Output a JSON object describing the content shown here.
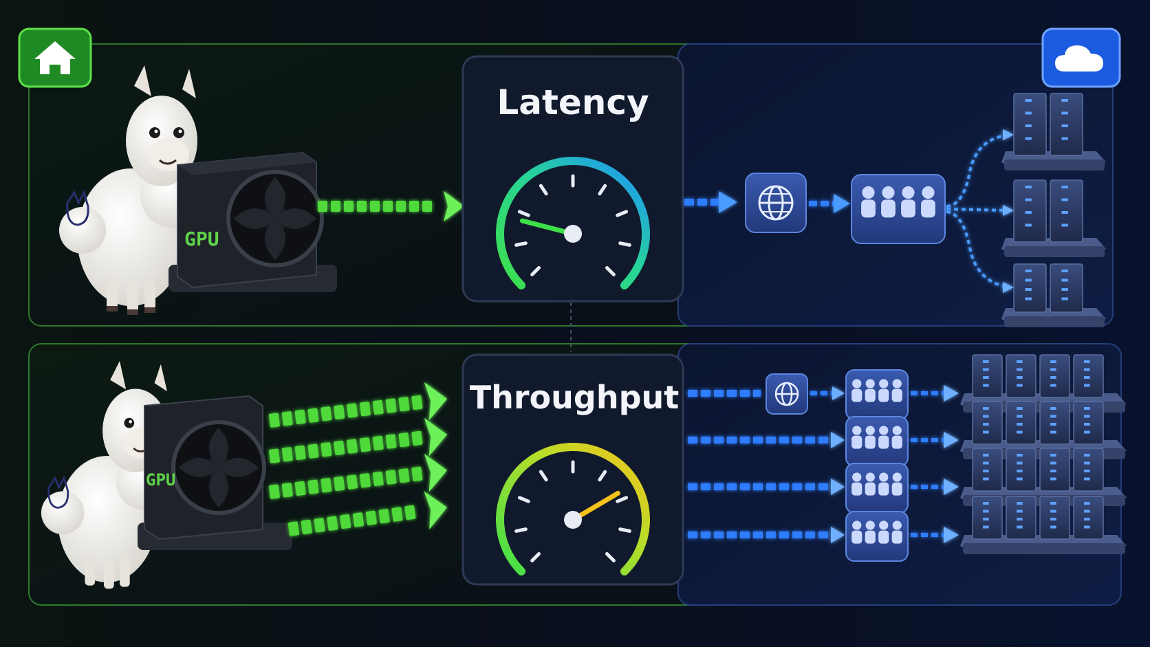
{
  "panels": {
    "latency": {
      "title": "Latency",
      "gauge_level": 0.22,
      "gpu_label": "GPU"
    },
    "throughput": {
      "title": "Throughput",
      "gauge_level": 0.72,
      "gpu_label": "GPU"
    }
  },
  "icons": {
    "local": "home-icon",
    "cloud": "cloud-icon",
    "network": "globe-icon",
    "users": "users-group-icon",
    "servers": "server-rack-icon",
    "mascot": "llama-icon",
    "hardware": "gpu-icon",
    "gauge": "speedometer-icon"
  },
  "colors": {
    "background": "#070b16",
    "local_accent": "#4fd93a",
    "cloud_accent": "#2f7dff",
    "panel_border_local": "#2f7a2c",
    "panel_border_cloud": "#243e7a",
    "gauge_low": "#3ee04a",
    "gauge_mid": "#1ec9c9",
    "gauge_high": "#f5c21b"
  }
}
